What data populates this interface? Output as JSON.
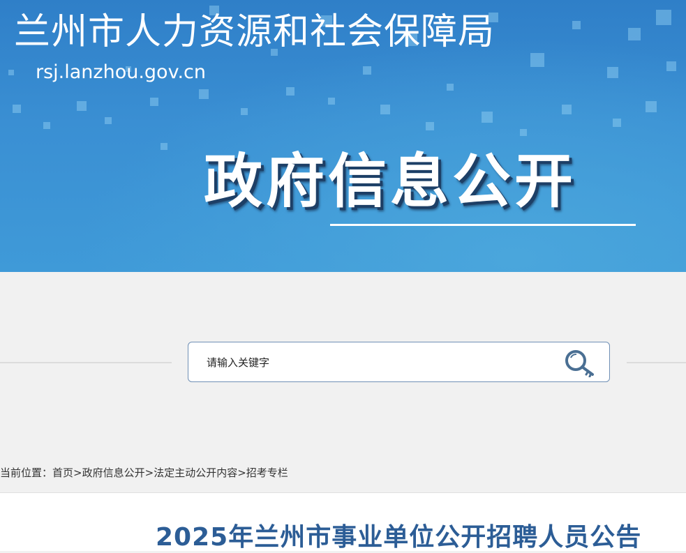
{
  "header": {
    "agency_name": "兰州市人力资源和社会保障局",
    "domain": "rsj.lanzhou.gov.cn",
    "section_title": "政府信息公开",
    "background_color": "#3a8fd3"
  },
  "search": {
    "placeholder": "请输入关键字",
    "button_icon": "search-key-icon"
  },
  "breadcrumb": {
    "prefix": "当前位置：",
    "items": [
      "首页",
      "政府信息公开",
      "法定主动公开内容",
      "招考专栏"
    ],
    "separator": ">"
  },
  "article": {
    "title": "2025年兰州市事业单位公开招聘人员公告",
    "title_color": "#2c5d96"
  }
}
